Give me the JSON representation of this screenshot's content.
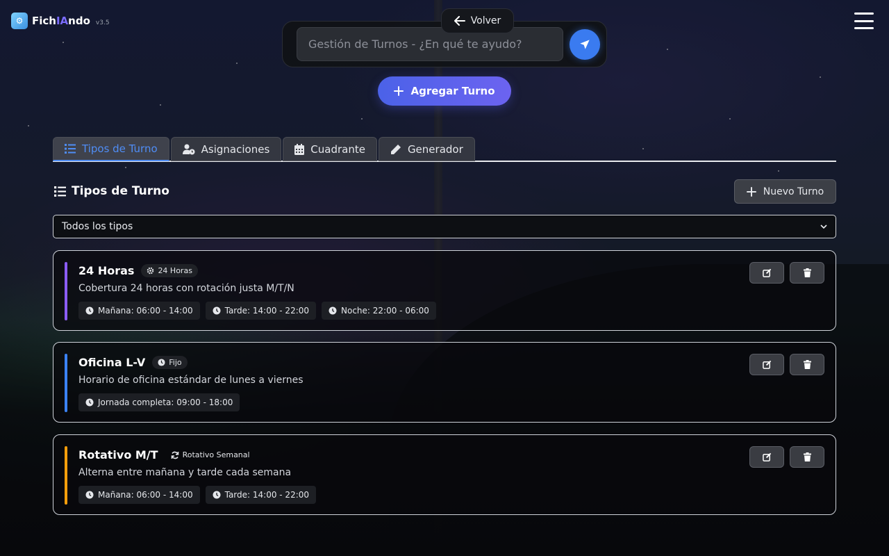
{
  "header": {
    "logo_text_a": "Fich",
    "logo_text_b": "IA",
    "logo_text_c": "ndo",
    "version": "v3.5",
    "back_label": "Volver"
  },
  "search": {
    "placeholder": "Gestión de Turnos - ¿En qué te ayudo?"
  },
  "primary_action": {
    "label": "Agregar Turno"
  },
  "tabs": [
    {
      "label": "Tipos de Turno",
      "icon": "list-icon",
      "active": true
    },
    {
      "label": "Asignaciones",
      "icon": "user-clock-icon",
      "active": false
    },
    {
      "label": "Cuadrante",
      "icon": "calendar-icon",
      "active": false
    },
    {
      "label": "Generador",
      "icon": "pencil-icon",
      "active": false
    }
  ],
  "section": {
    "title": "Tipos de Turno",
    "new_label": "Nuevo Turno"
  },
  "filter": {
    "selected": "Todos los tipos"
  },
  "shift_types": [
    {
      "name": "24 Horas",
      "badge": "24 Horas",
      "badge_icon": "gear-icon",
      "color": "#8b5cf6",
      "description": "Cobertura 24 horas con rotación justa M/T/N",
      "shifts": [
        "Mañana: 06:00 - 14:00",
        "Tarde: 14:00 - 22:00",
        "Noche: 22:00 - 06:00"
      ]
    },
    {
      "name": "Oficina L-V",
      "badge": "Fijo",
      "badge_icon": "clock-icon",
      "color": "#3b82f6",
      "description": "Horario de oficina estándar de lunes a viernes",
      "shifts": [
        "Jornada completa: 09:00 - 18:00"
      ]
    },
    {
      "name": "Rotativo M/T",
      "badge": "Rotativo Semanal",
      "badge_icon": "sync-icon",
      "color": "#f59e0b",
      "description": "Alterna entre mañana y tarde cada semana",
      "shifts": [
        "Mañana: 06:00 - 14:00",
        "Tarde: 14:00 - 22:00"
      ]
    }
  ]
}
